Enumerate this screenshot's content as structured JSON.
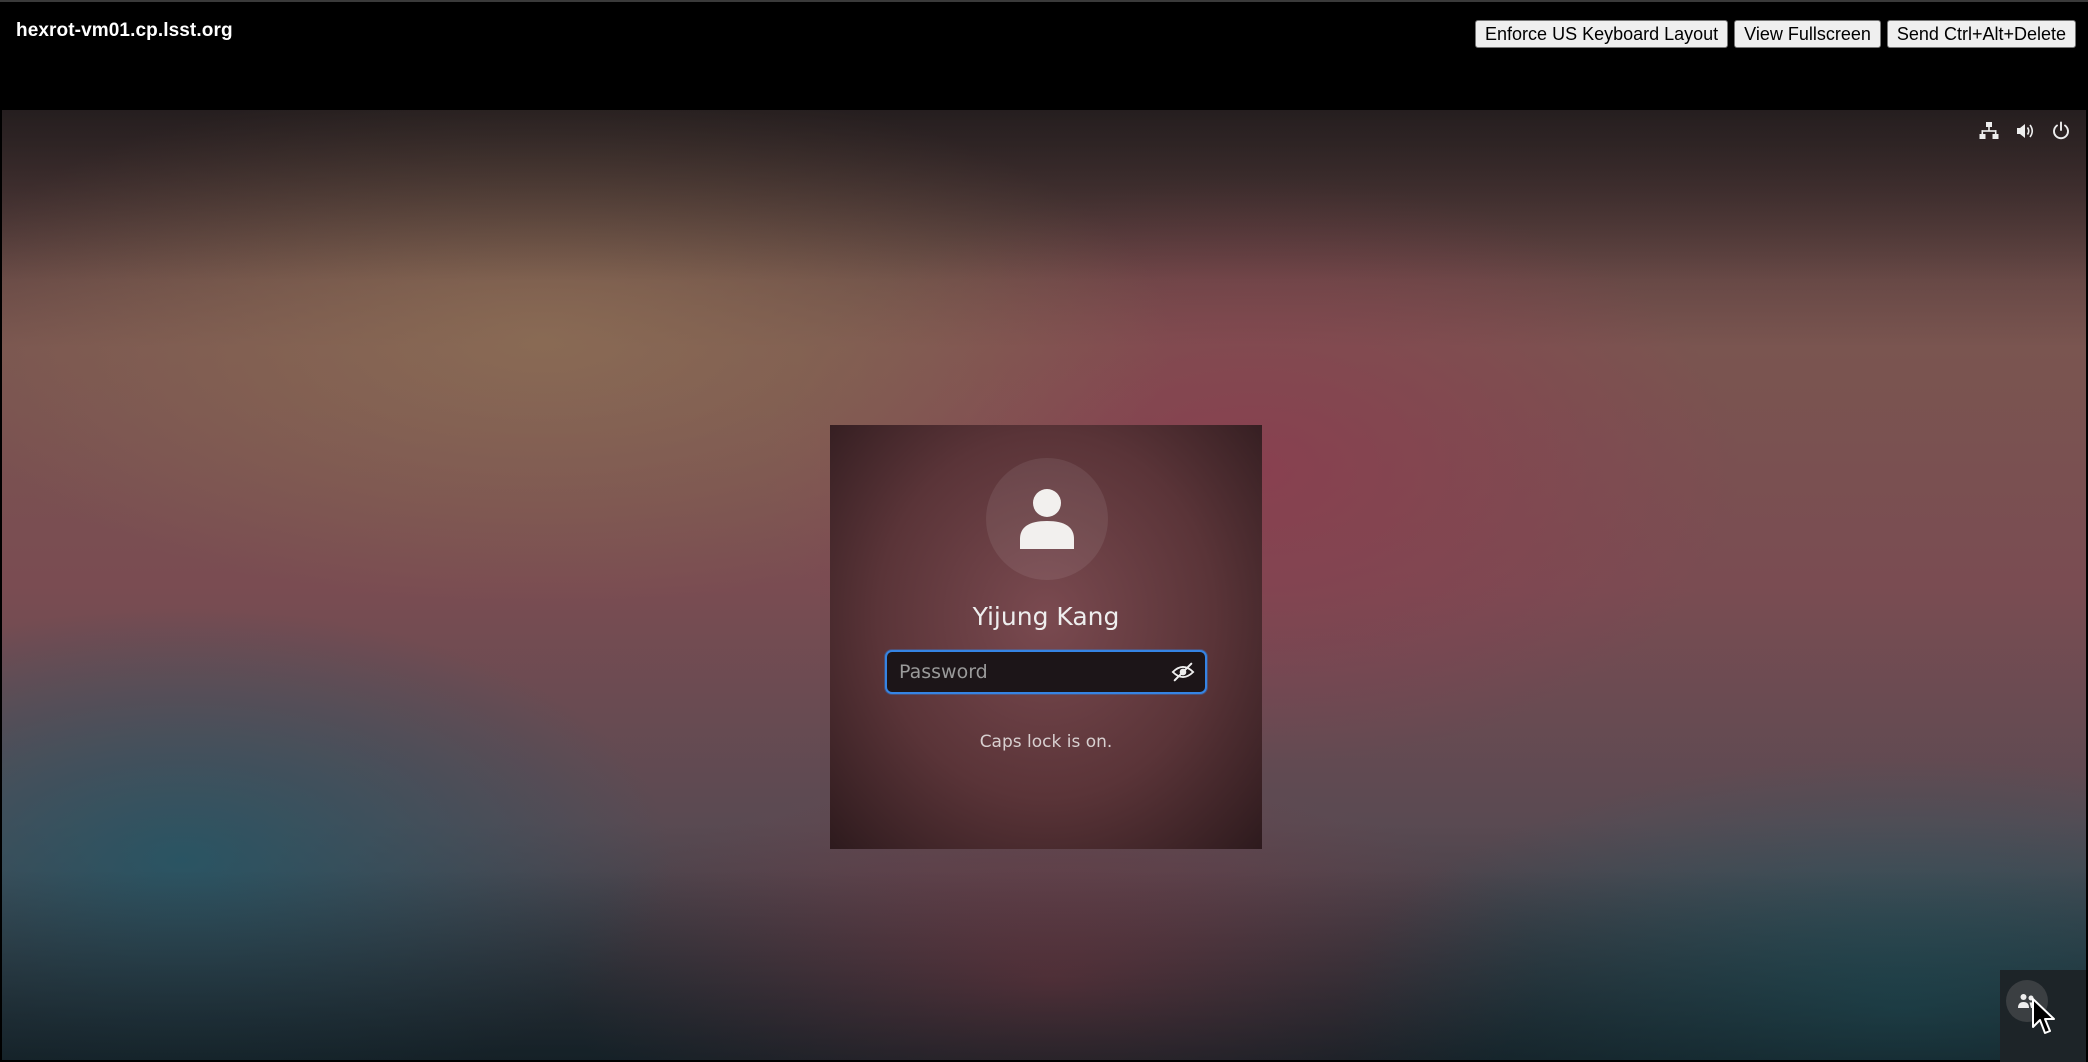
{
  "topbar": {
    "host": "hexrot-vm01.cp.lsst.org",
    "buttons": [
      {
        "label": "Enforce US Keyboard Layout"
      },
      {
        "label": "View Fullscreen"
      },
      {
        "label": "Send Ctrl+Alt+Delete"
      }
    ]
  },
  "tray": {
    "icons": [
      "network-wired-icon",
      "volume-icon",
      "power-icon"
    ]
  },
  "login": {
    "user_name": "Yijung Kang",
    "password_placeholder": "Password",
    "password_value": "",
    "caps_lock_message": "Caps lock is on.",
    "avatar_icon": "user-avatar-icon",
    "reveal_icon": "eye-slash-icon"
  },
  "bottom": {
    "users_icon": "switch-user-icon"
  },
  "colors": {
    "focus_ring": "#3584e4",
    "topbar_bg": "#000000"
  }
}
